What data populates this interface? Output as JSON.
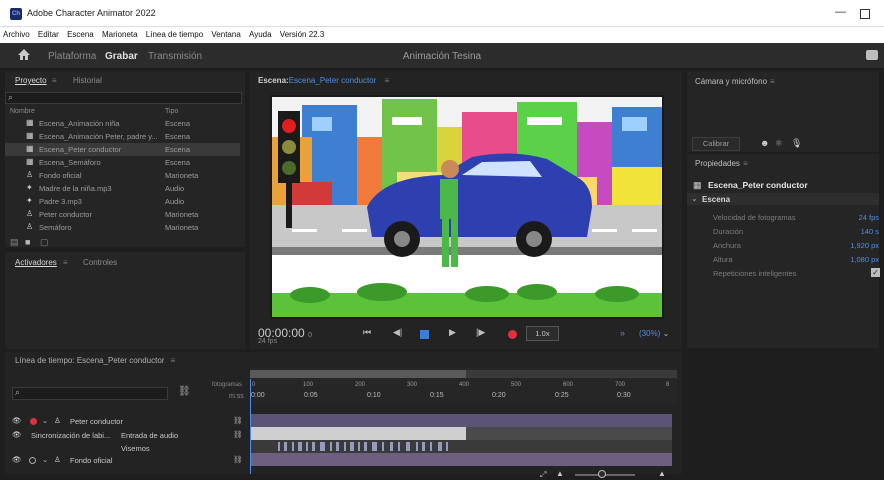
{
  "window": {
    "title": "Adobe Character Animator 2022",
    "app_icon": "Ch"
  },
  "menu": [
    "Archivo",
    "Editar",
    "Escena",
    "Marioneta",
    "Línea de tiempo",
    "Ventana",
    "Ayuda",
    "Versión 22.3"
  ],
  "workspace": {
    "tabs": [
      "Plataforma",
      "Grabar",
      "Transmisión"
    ],
    "active": "Grabar",
    "project_name": "Animación Tesina"
  },
  "project_panel": {
    "tabs": [
      "Proyecto",
      "Historial"
    ],
    "col_name": "Nombre",
    "col_type": "Tipo",
    "items": [
      {
        "name": "Escena_Animación niña",
        "type": "Escena",
        "icon": "scene-icon"
      },
      {
        "name": "Escena_Animación Peter, padre y...",
        "type": "Escena",
        "icon": "scene-icon"
      },
      {
        "name": "Escena_Peter conductor",
        "type": "Escena",
        "icon": "scene-icon",
        "selected": true
      },
      {
        "name": "Escena_Semáforo",
        "type": "Escena",
        "icon": "scene-icon"
      },
      {
        "name": "Fondo oficial",
        "type": "Marioneta",
        "icon": "puppet-icon"
      },
      {
        "name": "Madre de la niña.mp3",
        "type": "Audio",
        "icon": "audio-icon"
      },
      {
        "name": "Padre 3.mp3",
        "type": "Audio",
        "icon": "audio-icon"
      },
      {
        "name": "Peter conductor",
        "type": "Marioneta",
        "icon": "puppet-icon"
      },
      {
        "name": "Semáforo",
        "type": "Marioneta",
        "icon": "puppet-icon"
      }
    ]
  },
  "activators_panel": {
    "tabs": [
      "Activadores",
      "Controles"
    ]
  },
  "scene_panel": {
    "label": "Escena:",
    "scene_name": "Escena_Peter conductor",
    "timecode": "00:00:00",
    "timecode_frame": "0",
    "fps": "24 fps",
    "speed": "1.0x",
    "zoom": "(30%)"
  },
  "camera_panel": {
    "title": "Cámara y micrófono",
    "calibrate": "Calibrar"
  },
  "properties_panel": {
    "title": "Propiedades",
    "scene_name": "Escena_Peter conductor",
    "section": "Escena",
    "rows": [
      {
        "label": "Velocidad de fotogramas",
        "value": "24 fps"
      },
      {
        "label": "Duración",
        "value": "140 s"
      },
      {
        "label": "Anchura",
        "value": "1,920 px"
      },
      {
        "label": "Altura",
        "value": "1,080 px"
      },
      {
        "label": "Repeticiones inteligentes",
        "value": ""
      }
    ],
    "smart_repeats_checked": true
  },
  "timeline": {
    "title": "Línea de tiempo: Escena_Peter conductor",
    "frames_label": "fotogramas",
    "time_label": "m:ss",
    "frame_ticks": [
      "0",
      "100",
      "200",
      "300",
      "400",
      "500",
      "600",
      "700",
      "8"
    ],
    "time_ticks": [
      "0:00",
      "0:05",
      "0:10",
      "0:15",
      "0:20",
      "0:25",
      "0:30"
    ],
    "tracks": [
      {
        "name": "Peter conductor"
      },
      {
        "name": "Sincronización de labi...",
        "sub": "Entrada de audio"
      },
      {
        "name": "",
        "sub": "Visemos"
      },
      {
        "name": "Fondo oficial"
      }
    ]
  },
  "colors": {
    "accent_blue": "#4d8fe8",
    "record_red": "#e0313a",
    "track_purple": "#5b5476"
  }
}
